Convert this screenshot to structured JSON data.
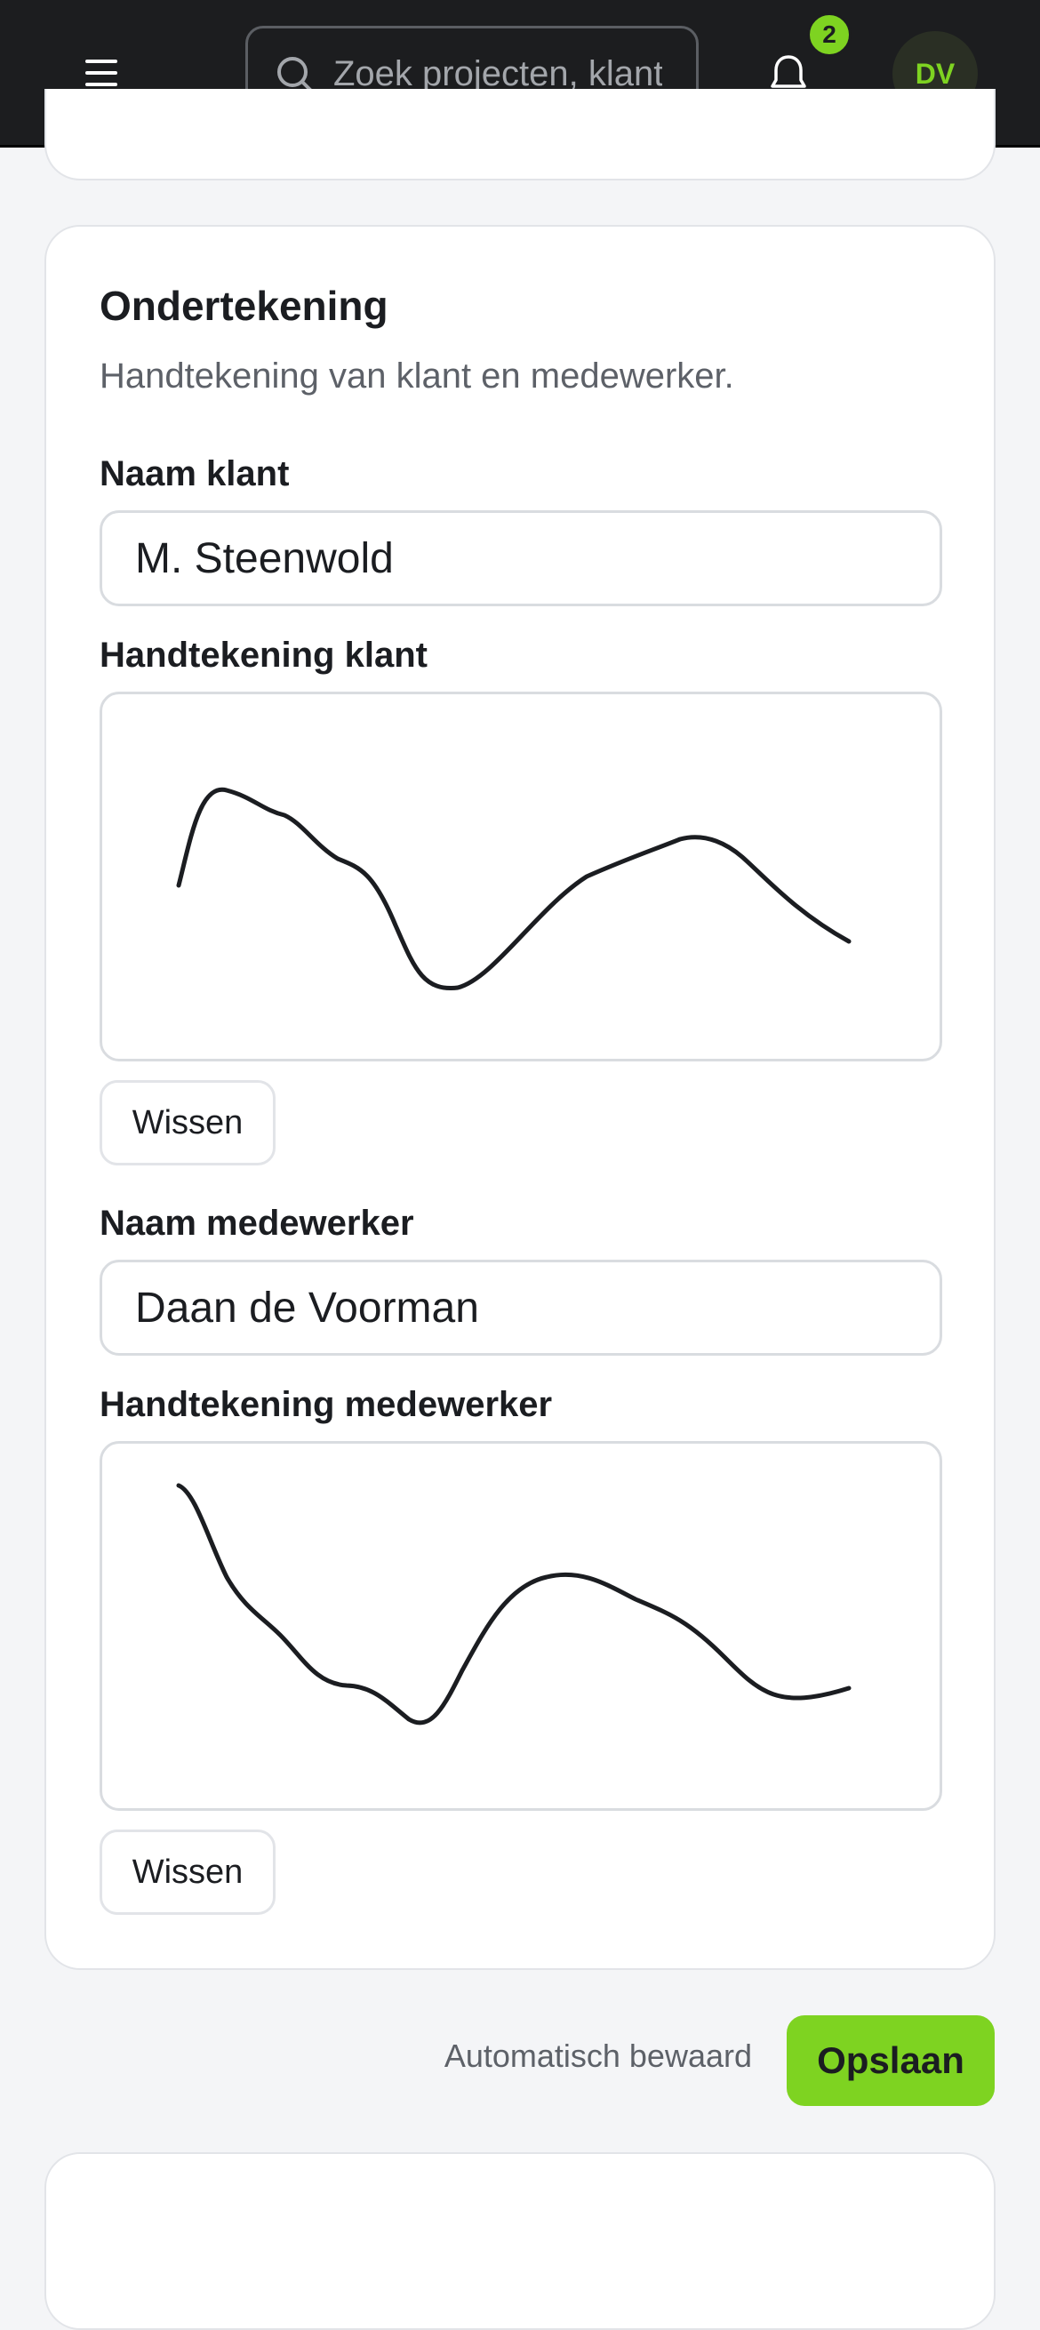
{
  "header": {
    "menu_icon": "hamburger-menu-icon",
    "search": {
      "placeholder": "Zoek projecten, klanten…",
      "icon": "search-icon"
    },
    "notifications": {
      "icon": "bell-icon",
      "count": "2"
    },
    "avatar_initials": "DV"
  },
  "signature_section": {
    "title": "Ondertekening",
    "subtitle": "Handtekening van klant en medewerker.",
    "client": {
      "name_label": "Naam klant",
      "name_value": "M. Steenwold",
      "signature_label": "Handtekening klant",
      "clear_label": "Wissen"
    },
    "employee": {
      "name_label": "Naam medewerker",
      "name_value": "Daan de Voorman",
      "signature_label": "Handtekening medewerker",
      "clear_label": "Wissen"
    }
  },
  "footer_actions": {
    "autosave_status": "Automatisch bewaard",
    "save_label": "Opslaan"
  },
  "colors": {
    "accent": "#7ed321",
    "topbar": "#1c1d1f",
    "background": "#f4f5f7",
    "ink": "#1b1d21"
  }
}
